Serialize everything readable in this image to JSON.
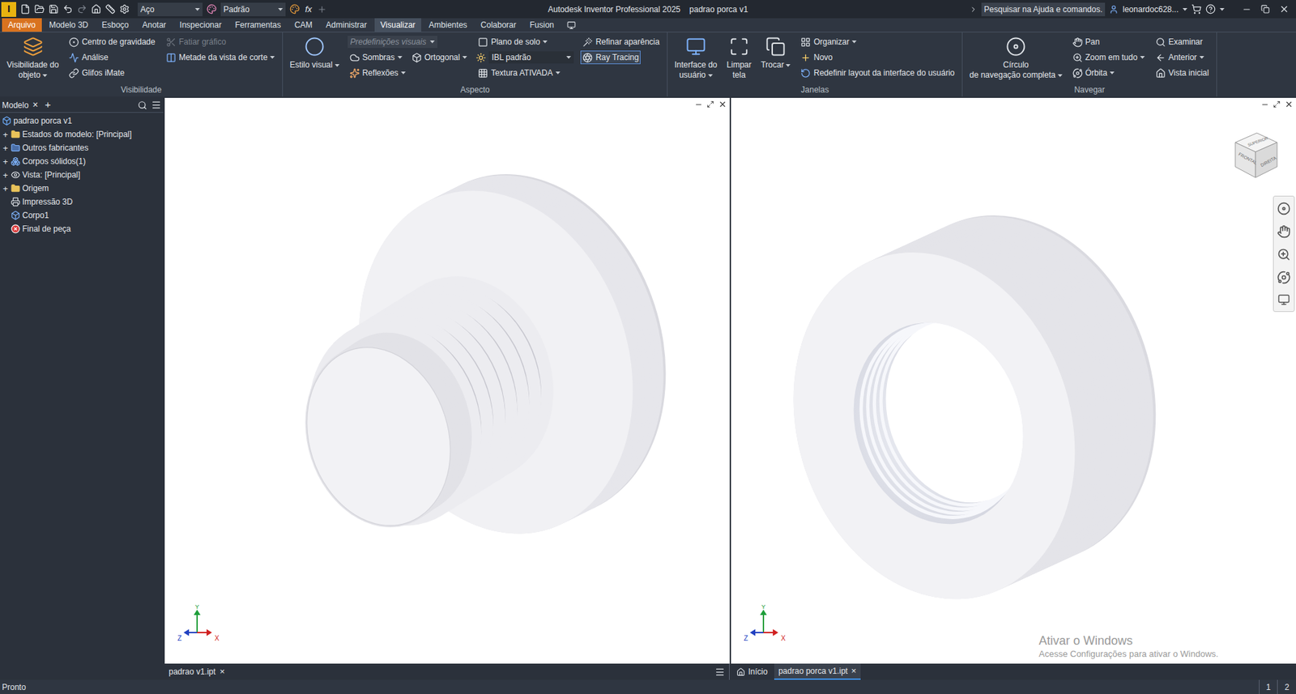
{
  "window": {
    "app_icon": "I",
    "title": "Autodesk Inventor Professional 2025",
    "document": "padrao porca v1"
  },
  "quick_access": {
    "material": "Aço",
    "appearance": "Padrão",
    "formula": "fx"
  },
  "search": {
    "placeholder": "Pesquisar na Ajuda e comandos."
  },
  "user": {
    "name": "leonardoc628..."
  },
  "ribbon_tabs": [
    {
      "label": "Arquivo",
      "selected": false,
      "kind": "app"
    },
    {
      "label": "Modelo 3D",
      "selected": false,
      "kind": "tab"
    },
    {
      "label": "Esboço",
      "selected": false,
      "kind": "tab"
    },
    {
      "label": "Anotar",
      "selected": false,
      "kind": "tab"
    },
    {
      "label": "Inspecionar",
      "selected": false,
      "kind": "tab"
    },
    {
      "label": "Ferramentas",
      "selected": false,
      "kind": "tab"
    },
    {
      "label": "CAM",
      "selected": false,
      "kind": "tab"
    },
    {
      "label": "Administrar",
      "selected": false,
      "kind": "tab"
    },
    {
      "label": "Visualizar",
      "selected": true,
      "kind": "tab"
    },
    {
      "label": "Ambientes",
      "selected": false,
      "kind": "tab"
    },
    {
      "label": "Colaborar",
      "selected": false,
      "kind": "tab"
    },
    {
      "label": "Fusion",
      "selected": false,
      "kind": "tab"
    }
  ],
  "ribbon_groups": [
    {
      "title": "Visibilidade",
      "columns": [
        {
          "kind": "large",
          "lines": [
            "Visibilidade do",
            "objeto"
          ],
          "dropdown": true
        },
        {
          "kind": "stack",
          "rows": [
            [
              {
                "label": "Centro de gravidade",
                "kind": "button",
                "disabled": false,
                "dropdown": false,
                "selected": false
              }
            ],
            [
              {
                "label": "Análise",
                "kind": "button",
                "disabled": false,
                "dropdown": false,
                "selected": false
              }
            ],
            [
              {
                "label": "Glifos iMate",
                "kind": "button",
                "disabled": false,
                "dropdown": false,
                "selected": false
              }
            ]
          ]
        },
        {
          "kind": "stack",
          "rows": [
            [
              {
                "label": "Fatiar gráfico",
                "kind": "button",
                "disabled": true,
                "dropdown": false,
                "selected": false
              }
            ],
            [
              {
                "label": "Metade da vista de corte",
                "kind": "button",
                "disabled": false,
                "dropdown": true,
                "selected": false
              }
            ]
          ]
        }
      ]
    },
    {
      "title": "Aspecto",
      "columns": [
        {
          "kind": "large",
          "lines": [
            "Estilo visual"
          ],
          "dropdown": true
        },
        {
          "kind": "stack",
          "rows": [
            [
              {
                "label": "Predefinições visuais",
                "kind": "combo",
                "disabled": true,
                "dropdown": true,
                "selected": false
              }
            ],
            [
              {
                "label": "Sombras",
                "kind": "button",
                "disabled": false,
                "dropdown": true,
                "selected": false
              },
              {
                "label": "Ortogonal",
                "kind": "button",
                "disabled": false,
                "dropdown": true,
                "selected": false
              }
            ],
            [
              {
                "label": "Reflexões",
                "kind": "button",
                "disabled": false,
                "dropdown": true,
                "selected": false
              }
            ]
          ]
        },
        {
          "kind": "stack",
          "rows": [
            [
              {
                "label": "Plano de solo",
                "kind": "button",
                "disabled": false,
                "dropdown": true,
                "selected": false
              }
            ],
            [
              {
                "label": "IBL padrão",
                "kind": "combo",
                "disabled": false,
                "dropdown": true,
                "selected": false
              }
            ],
            [
              {
                "label": "Textura ATIVADA",
                "kind": "button",
                "disabled": false,
                "dropdown": true,
                "selected": false
              }
            ]
          ]
        },
        {
          "kind": "stack",
          "rows": [
            [
              {
                "label": "Refinar aparência",
                "kind": "button",
                "disabled": false,
                "dropdown": false,
                "selected": false
              }
            ],
            [
              {
                "label": "Ray Tracing",
                "kind": "button",
                "disabled": false,
                "dropdown": false,
                "selected": true
              }
            ]
          ]
        }
      ]
    },
    {
      "title": "Janelas",
      "columns": [
        {
          "kind": "large",
          "lines": [
            "Interface do",
            "usuário"
          ],
          "dropdown": true
        },
        {
          "kind": "large",
          "lines": [
            "Limpar",
            "tela"
          ],
          "dropdown": false
        },
        {
          "kind": "large",
          "lines": [
            "Trocar"
          ],
          "dropdown": true
        },
        {
          "kind": "stack",
          "rows": [
            [
              {
                "label": "Organizar",
                "kind": "button",
                "disabled": false,
                "dropdown": true,
                "selected": false
              }
            ],
            [
              {
                "label": "Novo",
                "kind": "button",
                "disabled": false,
                "dropdown": false,
                "selected": false
              }
            ],
            [
              {
                "label": "Redefinir layout da interface do usuário",
                "kind": "button",
                "disabled": false,
                "dropdown": false,
                "selected": false
              }
            ]
          ]
        }
      ]
    },
    {
      "title": "Navegar",
      "columns": [
        {
          "kind": "large",
          "lines": [
            "Círculo",
            "de navegação completa"
          ],
          "dropdown": true
        },
        {
          "kind": "stack",
          "rows": [
            [
              {
                "label": "Pan",
                "kind": "button",
                "disabled": false,
                "dropdown": false,
                "selected": false
              }
            ],
            [
              {
                "label": "Zoom em tudo",
                "kind": "button",
                "disabled": false,
                "dropdown": true,
                "selected": false
              }
            ],
            [
              {
                "label": "Órbita",
                "kind": "button",
                "disabled": false,
                "dropdown": true,
                "selected": false
              }
            ]
          ]
        },
        {
          "kind": "stack",
          "rows": [
            [
              {
                "label": "Examinar",
                "kind": "button",
                "disabled": false,
                "dropdown": false,
                "selected": false
              }
            ],
            [
              {
                "label": "Anterior",
                "kind": "button",
                "disabled": false,
                "dropdown": true,
                "selected": false
              }
            ],
            [
              {
                "label": "Vista inicial",
                "kind": "button",
                "disabled": false,
                "dropdown": false,
                "selected": false
              }
            ]
          ]
        }
      ]
    }
  ],
  "browser": {
    "title": "Modelo",
    "close": "×",
    "add": "+",
    "items": [
      {
        "label": "padrao porca v1",
        "kind": "part",
        "level": 0,
        "expander": ""
      },
      {
        "label": "Estados do modelo: [Principal]",
        "kind": "folder",
        "level": 1,
        "expander": "+"
      },
      {
        "label": "Outros fabricantes",
        "kind": "vendors",
        "level": 1,
        "expander": "+"
      },
      {
        "label": "Corpos sólidos(1)",
        "kind": "bodies",
        "level": 1,
        "expander": "+"
      },
      {
        "label": "Vista: [Principal]",
        "kind": "view",
        "level": 1,
        "expander": "+"
      },
      {
        "label": "Origem",
        "kind": "folder",
        "level": 1,
        "expander": "+"
      },
      {
        "label": "Impressão 3D",
        "kind": "print",
        "level": 1,
        "expander": ""
      },
      {
        "label": "Corpo1",
        "kind": "body",
        "level": 1,
        "expander": ""
      },
      {
        "label": "Final de peça",
        "kind": "end",
        "level": 1,
        "expander": ""
      }
    ]
  },
  "view_cube": {
    "faces": [
      "SUPERIOR",
      "FRONTAL",
      "DIREITA"
    ]
  },
  "axes": {
    "x": "X",
    "y": "Y",
    "z": "Z"
  },
  "document_tabs": {
    "left": [
      {
        "label": "padrao v1.ipt",
        "close": "×",
        "selected": false
      }
    ],
    "right": [
      {
        "label": "Início",
        "close": "",
        "selected": false
      },
      {
        "label": "padrao porca v1.ipt",
        "close": "×",
        "selected": true
      }
    ]
  },
  "watermark": {
    "title": "Ativar o Windows",
    "subtitle": "Acesse Configurações para ativar o Windows."
  },
  "status_bar": {
    "text": "Pronto",
    "pages": [
      "1",
      "2"
    ]
  }
}
